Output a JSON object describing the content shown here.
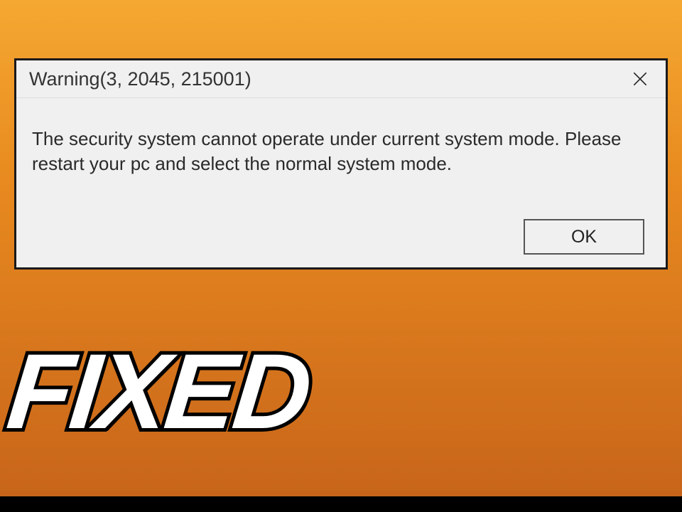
{
  "dialog": {
    "title": "Warning(3, 2045, 215001)",
    "message": "The security system cannot operate under current system mode. Please restart your pc and select the normal system mode.",
    "ok_label": "OK"
  },
  "banner": {
    "label": "FIXED"
  },
  "icons": {
    "close": "close-icon"
  },
  "colors": {
    "bg_top": "#f5a832",
    "bg_bottom": "#c6631a",
    "dialog_bg": "#f0f0f0",
    "dialog_border": "#1a1a1a"
  }
}
